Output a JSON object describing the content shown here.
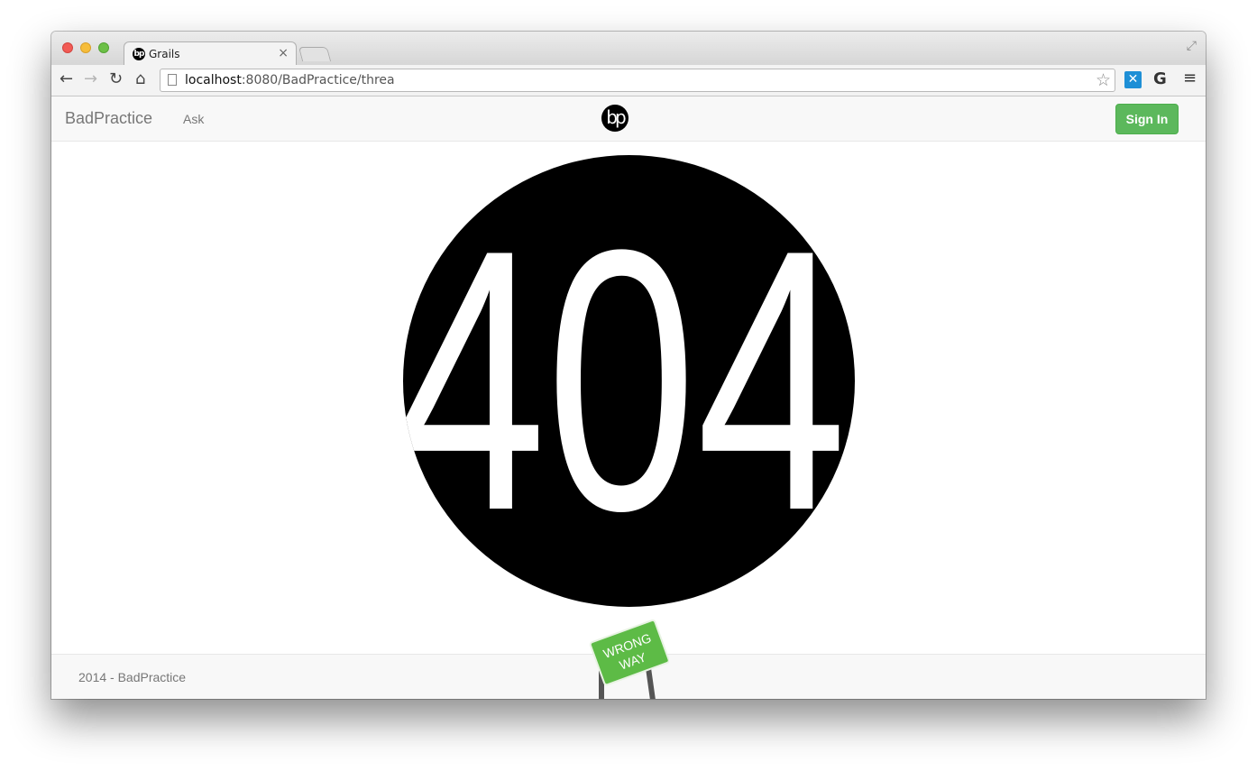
{
  "browser": {
    "tab_title": "Grails",
    "tab_favicon_text": "bp",
    "url_host": "localhost",
    "url_rest": ":8080/BadPractice/threa"
  },
  "navbar": {
    "brand": "BadPractice",
    "ask_link": "Ask",
    "logo_text": "bp",
    "signin_label": "Sign In",
    "signin_color": "#5cb85c"
  },
  "error": {
    "code": "404"
  },
  "sign": {
    "line1": "WRONG",
    "line2": "WAY",
    "color": "#5dbb46"
  },
  "footer": {
    "text": "2014 - BadPractice"
  }
}
